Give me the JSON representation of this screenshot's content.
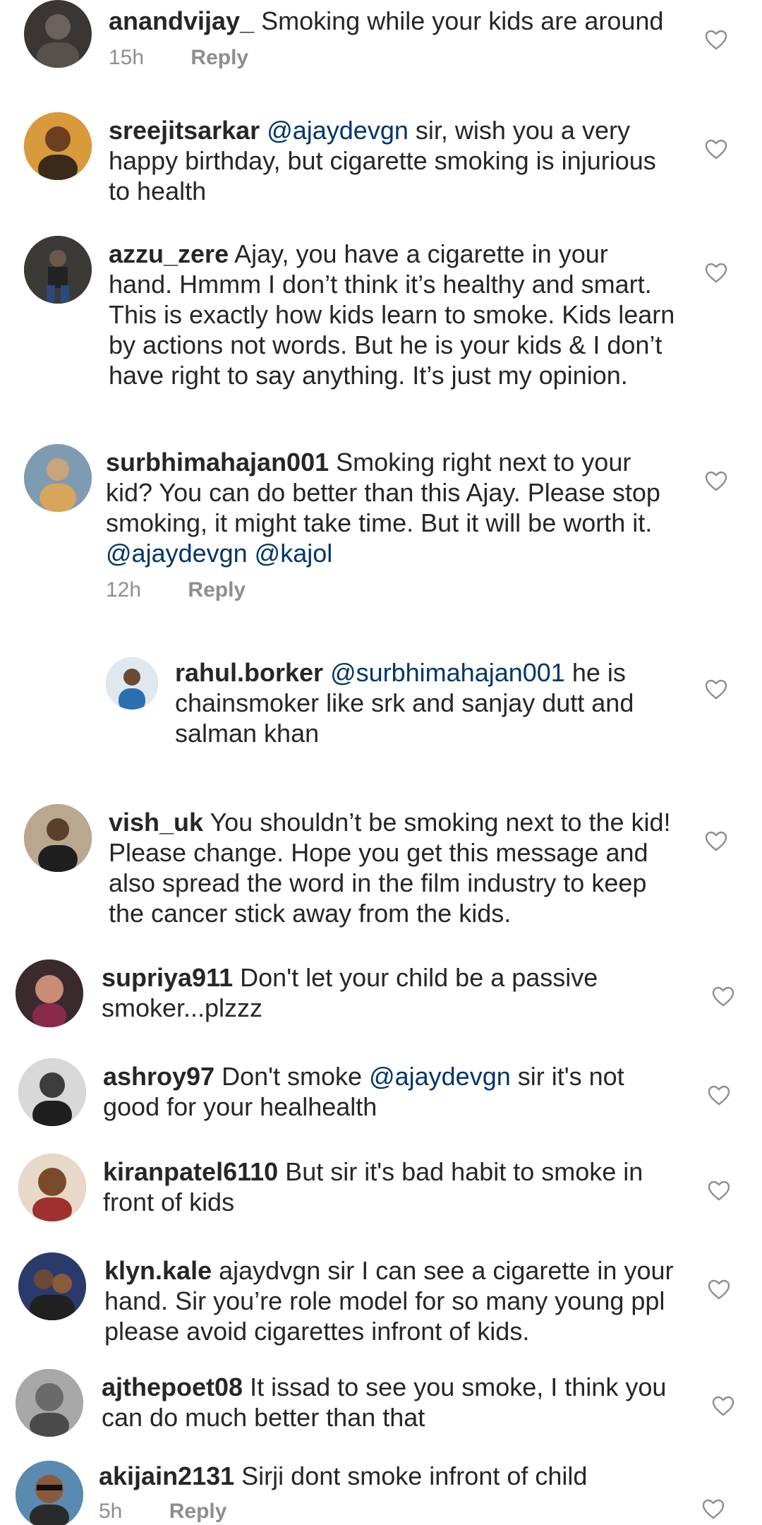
{
  "comments": [
    {
      "username": "anandvijay_",
      "text": "Smoking while your kids are around",
      "time": "15h",
      "reply_label": "Reply",
      "avatar_color": "#3a3633"
    },
    {
      "username": "sreejitsarkar",
      "mention": "@ajaydevgn",
      "text": " sir, wish you a very happy birthday,  but cigarette smoking is injurious to health",
      "avatar_color": "#8a5a2b"
    },
    {
      "username": "azzu_zere",
      "text": "Ajay, you have a cigarette in your hand. Hmmm I don’t think it’s healthy and smart. This is exactly how kids learn to smoke. Kids learn by actions not words. But he is your kids & I don’t have right to say anything. It’s just my opinion.",
      "avatar_color": "#4b4a48"
    },
    {
      "username": "surbhimahajan001",
      "text": "Smoking right next to your kid? You can do better than this Ajay. Please stop smoking, it might take time. But it will be worth it.",
      "mentions_after": "@ajaydevgn @kajol",
      "time": "12h",
      "reply_label": "Reply",
      "avatar_color": "#b58a8c"
    },
    {
      "username": "rahul.borker",
      "mention": "@surbhimahajan001",
      "text": " he is chainsmoker like srk and sanjay dutt and salman khan",
      "avatar_color": "#6f8fb0"
    },
    {
      "username": "vish_uk",
      "text": "You shouldn’t be smoking next to the kid! Please change. Hope you get this message and also spread the word in the film industry to keep the cancer stick away from the kids.",
      "avatar_color": "#6b5a48"
    },
    {
      "username": "supriya911",
      "text": "Don't let your child be a passive smoker...plzzz",
      "avatar_color": "#5a3a3e"
    },
    {
      "username": "ashroy97",
      "text": "Don't smoke ",
      "mention": "@ajaydevgn",
      "text_after": " sir it's not good for your healhealth",
      "avatar_color": "#7a7a7a"
    },
    {
      "username": "kiranpatel6110",
      "text": "But sir it's bad habit to smoke in front of kids",
      "avatar_color": "#8a6a4a"
    },
    {
      "username": "klyn.kale",
      "text": "ajaydvgn sir I can see a cigarette in your hand. Sir you’re role model for so many young ppl please avoid cigarettes infront of kids.",
      "avatar_color": "#3a4a6a"
    },
    {
      "username": "ajthepoet08",
      "text": "It issad to see you smoke, I think you can do much better than that",
      "avatar_color": "#8a8a8a"
    },
    {
      "username": "akijain2131",
      "text": "Sirji dont smoke infront of child",
      "time": "5h",
      "reply_label": "Reply",
      "avatar_color": "#4a6a8a"
    }
  ]
}
